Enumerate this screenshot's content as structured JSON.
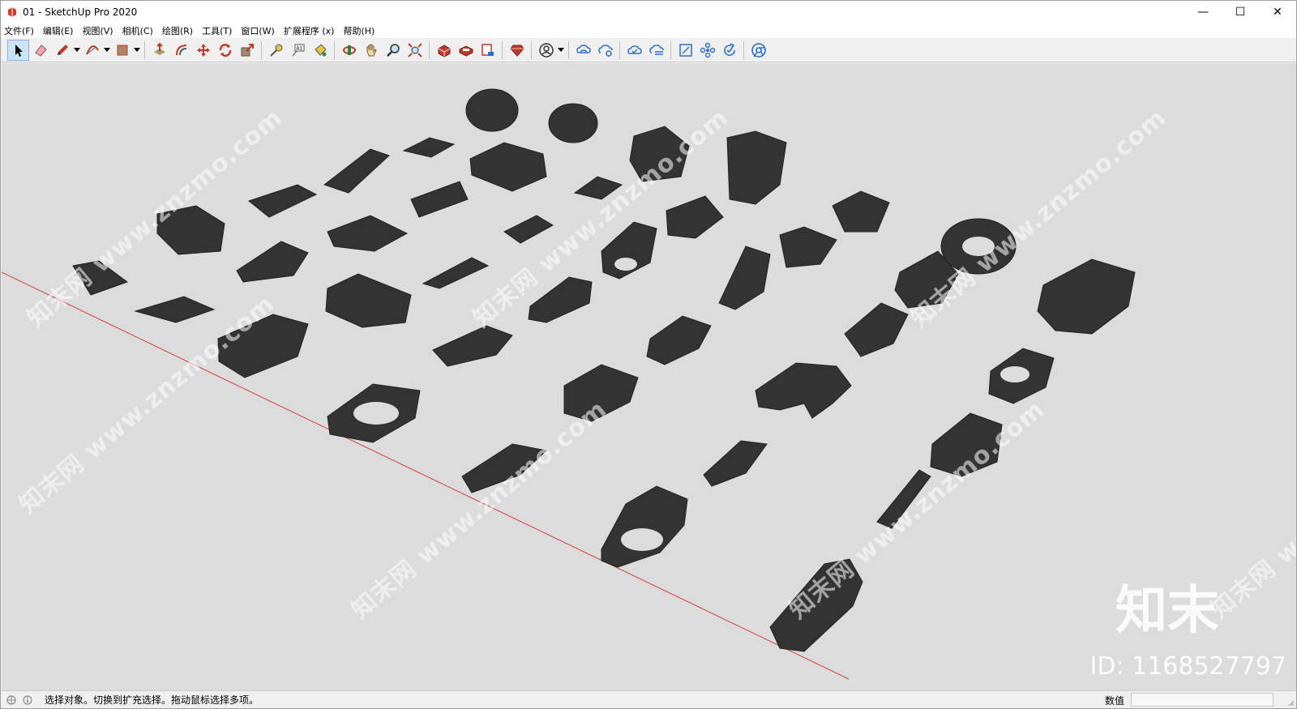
{
  "window": {
    "title": "01 - SketchUp Pro 2020",
    "minimize": "—",
    "maximize": "☐",
    "close": "✕"
  },
  "menu": [
    "文件(F)",
    "编辑(E)",
    "视图(V)",
    "相机(C)",
    "绘图(R)",
    "工具(T)",
    "窗口(W)",
    "扩展程序 (x)",
    "帮助(H)"
  ],
  "toolbar_icons": [
    "select-icon",
    "eraser-icon",
    "pencil-icon",
    "arc-icon",
    "rectangle-icon",
    "push-pull-icon",
    "offset-icon",
    "move-icon",
    "rotate-icon",
    "scale-icon",
    "tape-measure-icon",
    "text-icon",
    "paint-bucket-icon",
    "orbit-icon",
    "pan-icon",
    "zoom-icon",
    "zoom-extents-icon",
    "warehouse-icon",
    "extension-warehouse-icon",
    "send-to-layout-icon",
    "ruby-console-icon",
    "account-icon",
    "trimble-connect-icon",
    "trimble-share-icon",
    "cloud-sync-icon",
    "cloud-upload-icon",
    "bounding-box-icon",
    "components-icon",
    "refresh-icon",
    "chrome-icon"
  ],
  "viewport": {
    "watermark_text": "知末网 www.znzmo.com",
    "brand_logo": "知末",
    "brand_id": "ID: 1168527797",
    "background": "#dcdcdc",
    "model_color": "#333333",
    "axis_color": "#d04040"
  },
  "status": {
    "message": "选择对象。切换到扩充选择。拖动鼠标选择多项。",
    "value_label": "数值",
    "value_input": ""
  }
}
